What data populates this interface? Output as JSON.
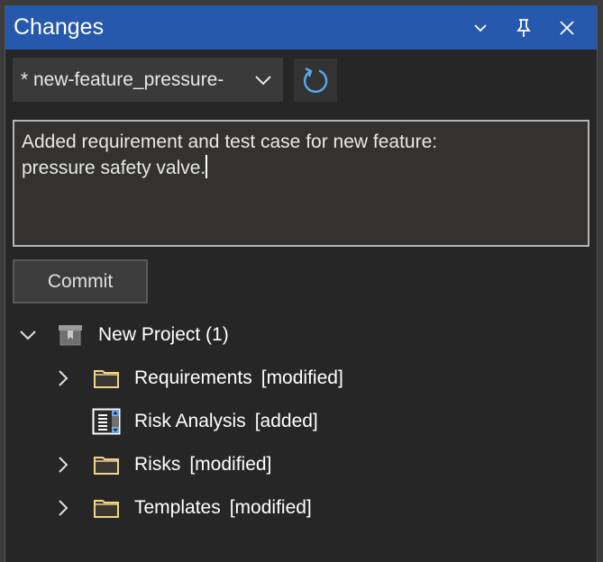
{
  "panel": {
    "title": "Changes",
    "colors": {
      "titlebar": "#2659ad",
      "folder_icon": "#f0d58c",
      "refresh_icon": "#5aaaf0",
      "doc_scroll_accent": "#6fa8e0"
    }
  },
  "titlebar_buttons": {
    "dropdown_icon": "chevron-down-icon",
    "pin_icon": "pin-icon",
    "close_icon": "close-icon"
  },
  "branch": {
    "selected": "* new-feature_pressure-",
    "dropdown_icon": "chevron-down-icon"
  },
  "refresh": {
    "icon": "refresh-icon"
  },
  "commit_message": {
    "value": "Added requirement and test case for new feature:\npressure safety valve."
  },
  "commit_button": {
    "label": "Commit"
  },
  "tree": {
    "root": {
      "label": "New Project (1)",
      "expanded": true,
      "icon": "project-archive-icon"
    },
    "children": [
      {
        "label": "Requirements",
        "status": "[modified]",
        "icon": "folder-icon",
        "expandable": true
      },
      {
        "label": "Risk Analysis",
        "status": "[added]",
        "icon": "document-list-icon",
        "expandable": false
      },
      {
        "label": "Risks",
        "status": "[modified]",
        "icon": "folder-icon",
        "expandable": true
      },
      {
        "label": "Templates",
        "status": "[modified]",
        "icon": "folder-icon",
        "expandable": true
      }
    ]
  }
}
